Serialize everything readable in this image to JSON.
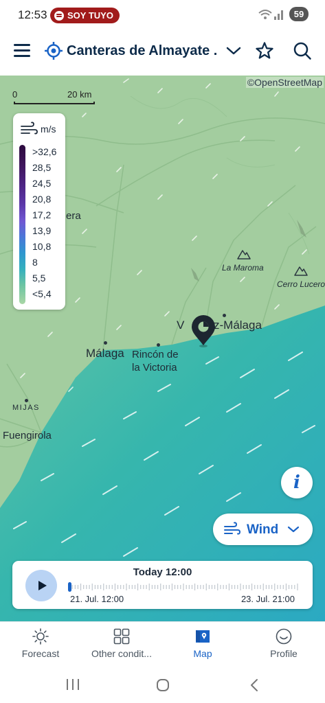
{
  "status_bar": {
    "time": "12:53",
    "media_label": "SOY TUYO",
    "battery": "59"
  },
  "header": {
    "title": "Canteras de Almayate ..."
  },
  "map": {
    "attribution": "©OpenStreetMap",
    "scale": {
      "start": "0",
      "end": "20 km"
    },
    "legend": {
      "unit": "m/s",
      "labels": [
        ">32,6",
        "28,5",
        "24,5",
        "20,8",
        "17,2",
        "13,9",
        "10,8",
        "8",
        "5,5",
        "<5,4"
      ]
    },
    "places": {
      "vera_partial": "era",
      "la_maroma": "La Maroma",
      "cerro_lucero": "Cerro Lucero",
      "velez_malaga_left": "V",
      "velez_malaga_right": "z-Málaga",
      "malaga": "Málaga",
      "rincon_line1": "Rincón de",
      "rincon_line2": "la Victoria",
      "mijas": "MIJAS",
      "fuengirola": "Fuengirola"
    },
    "layer_selector": {
      "label": "Wind"
    },
    "timeline": {
      "title": "Today 12:00",
      "start": "21. Jul. 12:00",
      "end": "23. Jul. 21:00",
      "progress": 0.0
    }
  },
  "bottom_nav": {
    "items": [
      {
        "label": "Forecast",
        "icon": "sun-icon"
      },
      {
        "label": "Other condit...",
        "icon": "grid-icon"
      },
      {
        "label": "Map",
        "icon": "map-icon",
        "active": true
      },
      {
        "label": "Profile",
        "icon": "smiley-icon"
      }
    ]
  },
  "colors": {
    "accent": "#1a63c6",
    "header_text": "#0d2b4a",
    "land": "#a3cd9f",
    "sea": "#33b6b0",
    "pill": "#a11b1b"
  }
}
